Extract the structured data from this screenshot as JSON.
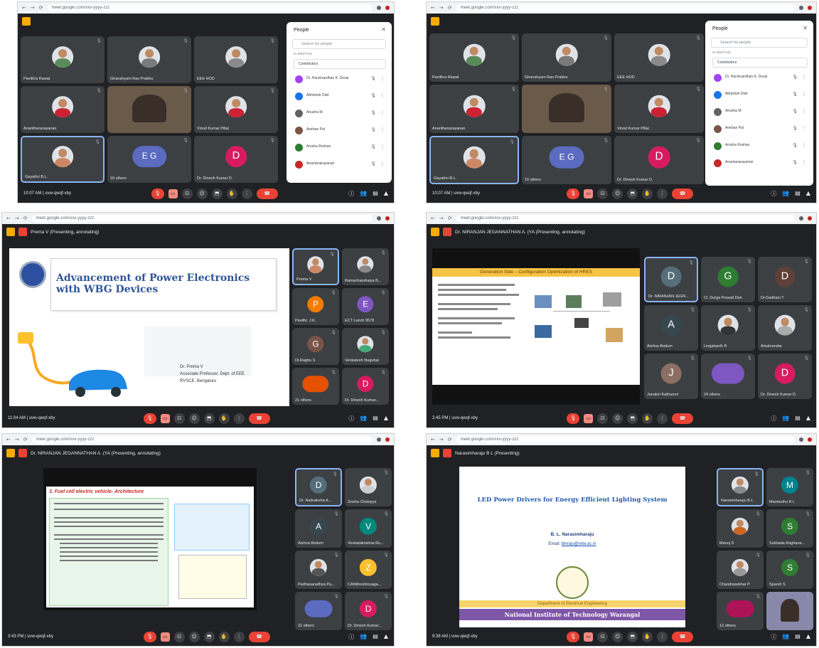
{
  "chrome": {
    "back": "←",
    "fwd": "→",
    "reload": "⟳",
    "url": "meet.google.com/xxx-yyyy-zzz"
  },
  "icons": {
    "mic": "mic-icon",
    "cam": "camera-icon",
    "cc": "captions-icon",
    "emoji": "emoji-icon",
    "present": "present-icon",
    "hand": "raise-hand-icon",
    "more": "more-icon",
    "end": "end-call-icon",
    "info": "info-icon",
    "people": "people-icon",
    "chat": "chat-icon",
    "activities": "activities-icon"
  },
  "glyphs": {
    "mic": "🎙",
    "cam": "▭",
    "cc": "⊡",
    "emoji": "☺",
    "present": "⬒",
    "hand": "✋",
    "more": "⋮",
    "end": "☎",
    "info": "ⓘ",
    "people": "👥",
    "chat": "▤",
    "act": "▲",
    "close": "✕",
    "search": "⌕",
    "muted": "🎙"
  },
  "panel": {
    "title": "People",
    "search_placeholder": "Search for people",
    "section": "IN MEETING",
    "contributors": "Contributors"
  },
  "people": [
    "Dr. Harshvardhan K. Desai",
    "Abhishek Dixit",
    "Anusha M.",
    "Anirban Pal",
    "Aruvha Roshan",
    "Anantanarayanan"
  ],
  "s1": {
    "time": "10:07 AM",
    "code": "uvw-qwqf-xby",
    "tiles": [
      {
        "name": "Pavithra Rawat",
        "initial": "",
        "color": "#5a8a5a",
        "kind": "photo"
      },
      {
        "name": "Ghanshyam Rao Prabhu",
        "initial": "",
        "color": "#7a7a7a",
        "kind": "photo"
      },
      {
        "name": "EEE HOD",
        "initial": "",
        "color": "#8a8a8a",
        "kind": "photo"
      },
      {
        "name": "Ananthanarayanan",
        "initial": "",
        "color": "#c23",
        "kind": "photo"
      },
      {
        "name": "",
        "initial": "",
        "color": "#6a5a4a",
        "kind": "video"
      },
      {
        "name": "Vinod Kumar Pillai",
        "initial": "",
        "color": "#c23",
        "kind": "photo"
      },
      {
        "name": "Gayathri B.L.",
        "initial": "",
        "color": "#c86",
        "kind": "photo"
      },
      {
        "name": "16 others",
        "initial": "E G",
        "color": "#5b6bc0",
        "kind": "multi"
      },
      {
        "name": "Dr. Dinesh Kumar D.",
        "initial": "D",
        "color": "#d81b60",
        "kind": "initial"
      }
    ]
  },
  "s2": {
    "time": "10:07 AM",
    "code": "uvw-qwqf-xby"
  },
  "s3": {
    "presenter": "Prema V (Presenting, annotating)",
    "slide_title": "Advancement of Power Electronics with WBG Devices",
    "author_name": "Dr. Prema V",
    "author_role": "Associate Professor, Dept. of EEE",
    "author_org": "RVSCE, Bengaluru",
    "time": "11:04 AM",
    "code": "uvw-qwqf-xby",
    "tiles": [
      {
        "name": "Prema V",
        "initial": "",
        "color": "#c86",
        "kind": "photo"
      },
      {
        "name": "Ramachandraiya B...",
        "initial": "",
        "color": "#888",
        "kind": "photo"
      },
      {
        "name": "Pavithr. J.K.",
        "initial": "P",
        "color": "#f57c00",
        "kind": "initial"
      },
      {
        "name": "ECT Lunch 9578",
        "initial": "E",
        "color": "#7e57c2",
        "kind": "initial"
      },
      {
        "name": "Dr.Raghu S",
        "initial": "G",
        "color": "#795548",
        "kind": "initial"
      },
      {
        "name": "Venkatesh Nuguhar",
        "initial": "",
        "color": "#4a7",
        "kind": "photo"
      },
      {
        "name": "21 others",
        "initial": "",
        "color": "#e65100",
        "kind": "multi"
      },
      {
        "name": "Dr. Dinesh Kumar...",
        "initial": "D",
        "color": "#d81b60",
        "kind": "initial"
      }
    ]
  },
  "s4": {
    "presenter": "Dr. NIRANJAN JEGANNATHAN A. (YA (Presenting, annotating)",
    "slide_title": "Generation Side – Configuration Optimization of HRES",
    "time": "2:45 PM",
    "code": "uvw-qwqf-xby",
    "tiles": [
      {
        "name": "Dr. NIRANJAN JEGN...",
        "initial": "D",
        "color": "#546e7a",
        "kind": "initial"
      },
      {
        "name": "Cl. Durga Prasad Dan",
        "initial": "G",
        "color": "#2e7d32",
        "kind": "initial"
      },
      {
        "name": "Dr.Gadhani T",
        "initial": "D",
        "color": "#5d4037",
        "kind": "initial"
      },
      {
        "name": "Aishna Bodum",
        "initial": "A",
        "color": "#37474f",
        "kind": "initial"
      },
      {
        "name": "Lingakanth R",
        "initial": "",
        "color": "#333",
        "kind": "photo"
      },
      {
        "name": "Amahumdar",
        "initial": "",
        "color": "#aaa",
        "kind": "photo"
      },
      {
        "name": "Janakiri Kathuroni",
        "initial": "J",
        "color": "#8d6e63",
        "kind": "initial"
      },
      {
        "name": "24 others",
        "initial": "",
        "color": "#7e57c2",
        "kind": "multi"
      },
      {
        "name": "Dr. Dinesh Kumar D.",
        "initial": "D",
        "color": "#d81b60",
        "kind": "initial"
      }
    ]
  },
  "s5": {
    "presenter": "Dr. NIRANJAN JEGANNATHAN A. (YA (Presenting, annotating)",
    "slide_title": "3. Fuel cell electric vehicle- Architecture",
    "time": "3:43 PM",
    "code": "uvw-qwqf-xby",
    "tiles": [
      {
        "name": "Dr. Nalinaksha A...",
        "initial": "D",
        "color": "#546e7a",
        "kind": "initial"
      },
      {
        "name": "Sneha Chebiyya",
        "initial": "",
        "color": "#ccc",
        "kind": "photo"
      },
      {
        "name": "Aishna Bodum",
        "initial": "A",
        "color": "#37474f",
        "kind": "initial"
      },
      {
        "name": "Venkatakrishna Ru...",
        "initial": "V",
        "color": "#00897b",
        "kind": "initial"
      },
      {
        "name": "Parthasaradhya Pa...",
        "initial": "",
        "color": "#555",
        "kind": "photo"
      },
      {
        "name": "CANtihoshinuaga...",
        "initial": "Z",
        "color": "#fbc02d",
        "kind": "initial"
      },
      {
        "name": "21 others",
        "initial": "",
        "color": "#5b6bc0",
        "kind": "multi"
      },
      {
        "name": "Dr. Dinesh Kumar...",
        "initial": "D",
        "color": "#d81b60",
        "kind": "initial"
      }
    ]
  },
  "s6": {
    "presenter": "Narasimharaju B L (Presenting)",
    "slide_title": "LED Power Drivers for Energy Efficient Lighting System",
    "slide_author": "B. L. Narasimharaju",
    "slide_email_label": "Email: ",
    "slide_email": "blnraju@nitw.ac.in",
    "slide_dept": "Department of Electrical Engineering",
    "slide_inst": "National Institute of Technology Warangal",
    "time": "9:38 AM",
    "code": "uvw-qwqf-xby",
    "tiles": [
      {
        "name": "Narasimharaju B.L.",
        "initial": "",
        "color": "#888",
        "kind": "photo"
      },
      {
        "name": "Marimuthu R L",
        "initial": "M",
        "color": "#00838f",
        "kind": "initial"
      },
      {
        "name": "Manoj S",
        "initial": "",
        "color": "#c62",
        "kind": "photo"
      },
      {
        "name": "Sukhada Raghava...",
        "initial": "S",
        "color": "#2e7d32",
        "kind": "initial"
      },
      {
        "name": "Chandrasekhar P",
        "initial": "",
        "color": "#999",
        "kind": "photo"
      },
      {
        "name": "Sparsh S",
        "initial": "S",
        "color": "#2e7d32",
        "kind": "initial"
      },
      {
        "name": "12 others",
        "initial": "",
        "color": "#ad1457",
        "kind": "multi"
      },
      {
        "name": "",
        "initial": "",
        "color": "#88a",
        "kind": "video"
      }
    ]
  }
}
